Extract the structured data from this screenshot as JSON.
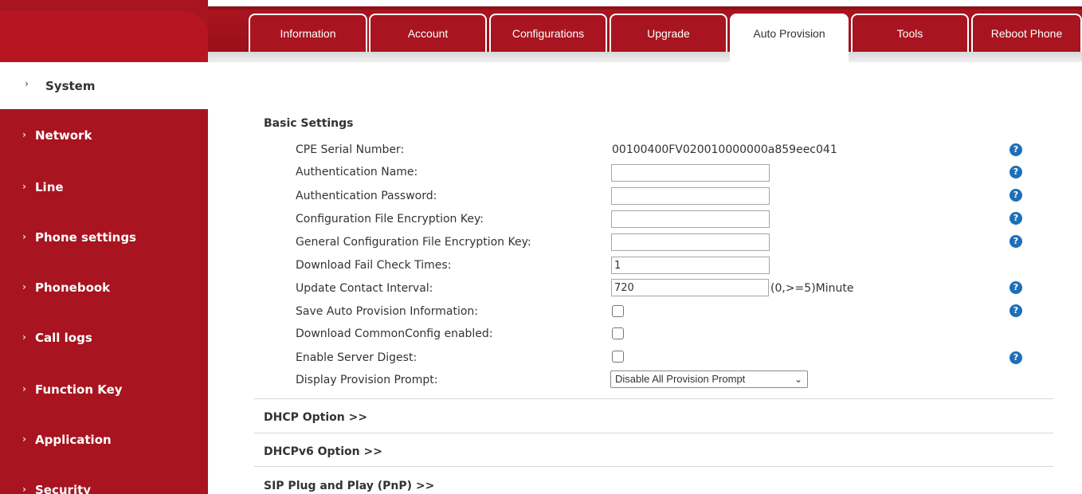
{
  "tabs": [
    {
      "label": "Information",
      "active": false
    },
    {
      "label": "Account",
      "active": false
    },
    {
      "label": "Configurations",
      "active": false
    },
    {
      "label": "Upgrade",
      "active": false
    },
    {
      "label": "Auto Provision",
      "active": true
    },
    {
      "label": "Tools",
      "active": false
    },
    {
      "label": "Reboot Phone",
      "active": false
    }
  ],
  "sidebar": {
    "current": {
      "label": "System",
      "chevron": "›"
    },
    "items": [
      {
        "label": "Network",
        "chevron": "›"
      },
      {
        "label": "Line",
        "chevron": "›"
      },
      {
        "label": "Phone settings",
        "chevron": "›"
      },
      {
        "label": "Phonebook",
        "chevron": "›"
      },
      {
        "label": "Call logs",
        "chevron": "›"
      },
      {
        "label": "Function Key",
        "chevron": "›"
      },
      {
        "label": "Application",
        "chevron": "›"
      },
      {
        "label": "Security",
        "chevron": "›"
      }
    ]
  },
  "basic_settings": {
    "title": "Basic Settings",
    "cpe_serial": {
      "label": "CPE Serial Number:",
      "value": "00100400FV020010000000a859eec041"
    },
    "auth_name": {
      "label": "Authentication Name:",
      "value": ""
    },
    "auth_password": {
      "label": "Authentication Password:",
      "value": ""
    },
    "config_key": {
      "label": "Configuration File Encryption Key:",
      "value": ""
    },
    "general_config_key": {
      "label": "General Configuration File Encryption Key:",
      "value": ""
    },
    "fail_check": {
      "label": "Download Fail Check Times:",
      "value": "1"
    },
    "update_interval": {
      "label": "Update Contact Interval:",
      "value": "720",
      "suffix": "(0,>=5)Minute"
    },
    "save_info": {
      "label": "Save Auto Provision Information:",
      "checked": false
    },
    "common_config": {
      "label": "Download CommonConfig enabled:",
      "checked": false
    },
    "server_digest": {
      "label": "Enable Server Digest:",
      "checked": false
    },
    "prompt": {
      "label": "Display Provision Prompt:",
      "selected": "Disable All Provision Prompt",
      "caret": "⌄"
    }
  },
  "sections": {
    "dhcp": "DHCP Option >>",
    "dhcpv6": "DHCPv6 Option >>",
    "sip_pnp": "SIP Plug and Play (PnP) >>"
  },
  "help_glyph": "?",
  "colors": {
    "brand": "#a8141f",
    "help": "#1d6fb8"
  }
}
